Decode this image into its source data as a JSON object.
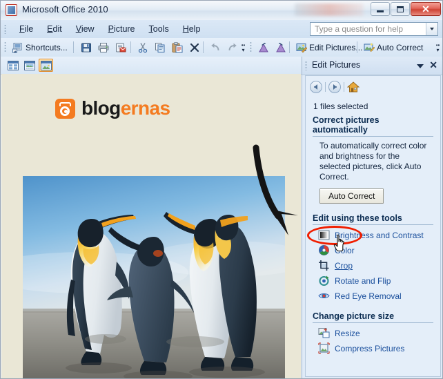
{
  "window": {
    "title": "Microsoft Office 2010",
    "icon": "office-picture-manager-icon",
    "buttons": {
      "minimize": "minimize-button",
      "maximize": "maximize-button",
      "close_glyph": "✕"
    }
  },
  "menubar": {
    "items": [
      {
        "label": "File",
        "accel": "F"
      },
      {
        "label": "Edit",
        "accel": "E"
      },
      {
        "label": "View",
        "accel": "V"
      },
      {
        "label": "Picture",
        "accel": "P"
      },
      {
        "label": "Tools",
        "accel": "T"
      },
      {
        "label": "Help",
        "accel": "H"
      }
    ],
    "help_box": {
      "placeholder": "Type a question for help",
      "value": ""
    }
  },
  "toolbar": {
    "shortcuts_label": "Shortcuts...",
    "edit_pictures_label": "Edit Pictures...",
    "auto_correct_label": "Auto Correct",
    "icons": [
      "shortcuts-icon",
      "save-icon",
      "print-icon",
      "email-icon",
      "cut-icon",
      "copy-icon",
      "paste-icon",
      "delete-icon",
      "undo-icon",
      "redo-icon",
      "rotate-left-icon",
      "rotate-right-icon",
      "edit-pictures-icon",
      "auto-correct-icon"
    ],
    "overflow_label": "»"
  },
  "viewbar": {
    "buttons": [
      {
        "name": "thumbnail-view",
        "active": false
      },
      {
        "name": "filmstrip-view",
        "active": false
      },
      {
        "name": "single-picture-view",
        "active": true
      }
    ]
  },
  "canvas": {
    "logo": {
      "text_dark": "blog",
      "text_accent": "ernas",
      "accent_color": "#f47b20",
      "dark_color": "#1a1a1a"
    },
    "photo": {
      "alt": "three king penguins on a beach",
      "sky_color": "#8cc0e4",
      "sand_color": "#8d8c86"
    },
    "annotation": {
      "type": "curved-arrow",
      "color": "#141414",
      "points_to": "Crop"
    },
    "background_color": "#eae7d6"
  },
  "task_pane": {
    "title": "Edit Pictures",
    "collapse_glyph": "▼",
    "close_glyph": "✕",
    "nav": [
      "back-icon",
      "forward-icon",
      "home-icon"
    ],
    "files_selected": "1 files selected",
    "sections": [
      {
        "heading": "Correct pictures automatically",
        "blurb": "To automatically correct color and brightness for the selected pictures, click Auto Correct.",
        "button": "Auto Correct"
      },
      {
        "heading": "Edit using these tools",
        "tools": [
          {
            "label": "Brightness and Contrast",
            "icon": "brightness-contrast-icon",
            "highlighted": false
          },
          {
            "label": "Color",
            "icon": "color-wheel-icon",
            "highlighted": false
          },
          {
            "label": "Crop",
            "icon": "crop-icon",
            "highlighted": true
          },
          {
            "label": "Rotate and Flip",
            "icon": "rotate-flip-icon",
            "highlighted": false
          },
          {
            "label": "Red Eye Removal",
            "icon": "red-eye-icon",
            "highlighted": false
          }
        ]
      },
      {
        "heading": "Change picture size",
        "tools": [
          {
            "label": "Resize",
            "icon": "resize-icon",
            "highlighted": false
          },
          {
            "label": "Compress Pictures",
            "icon": "compress-icon",
            "highlighted": false
          }
        ]
      }
    ],
    "highlight_color": "#f01e00",
    "cursor": "hand-pointer-cursor"
  }
}
